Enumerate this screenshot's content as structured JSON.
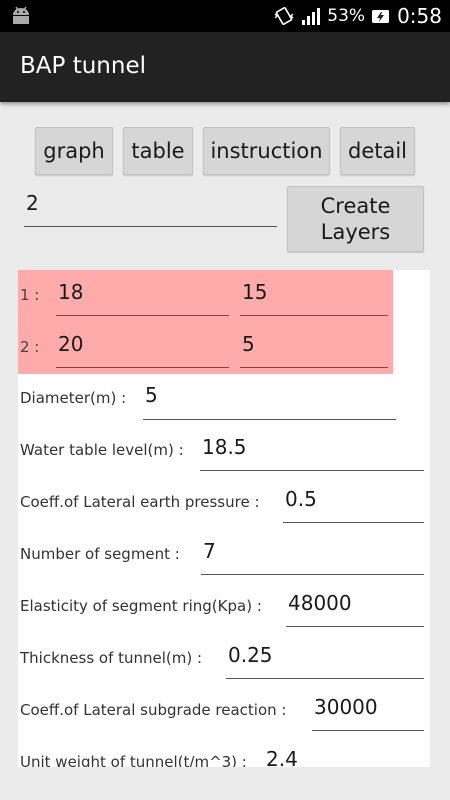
{
  "status_bar": {
    "battery_percent": "53%",
    "time": "0:58",
    "icons": [
      "android-icon",
      "vibrate-icon",
      "signal-icon",
      "battery-charging-icon"
    ]
  },
  "app": {
    "title": "BAP tunnel"
  },
  "tabs": [
    "graph",
    "table",
    "instruction",
    "detail"
  ],
  "layers_input": {
    "value": "2",
    "button_line1": "Create",
    "button_line2": "Layers"
  },
  "layers": [
    {
      "label": "1 :",
      "a": "18",
      "b": "15"
    },
    {
      "label": "2 :",
      "a": "20",
      "b": "5"
    }
  ],
  "params": [
    {
      "label": "Diameter(m)  :",
      "value": "5"
    },
    {
      "label": "Water table level(m)  :",
      "value": "18.5"
    },
    {
      "label": "Coeff.of Lateral earth pressure  :",
      "value": "0.5"
    },
    {
      "label": "Number of segment  :",
      "value": "7"
    },
    {
      "label": "Elasticity of segment ring(Kpa)  :",
      "value": "48000"
    },
    {
      "label": "Thickness of tunnel(m)  :",
      "value": "0.25"
    },
    {
      "label": "Coeff.of Lateral subgrade reaction  :",
      "value": "30000"
    },
    {
      "label": "Unit weight of tunnel(t/m^3)  :",
      "value": "2.4"
    }
  ],
  "colors": {
    "layer_bg": "#ffabab",
    "action_bar": "#222222",
    "background": "#ebebeb"
  }
}
